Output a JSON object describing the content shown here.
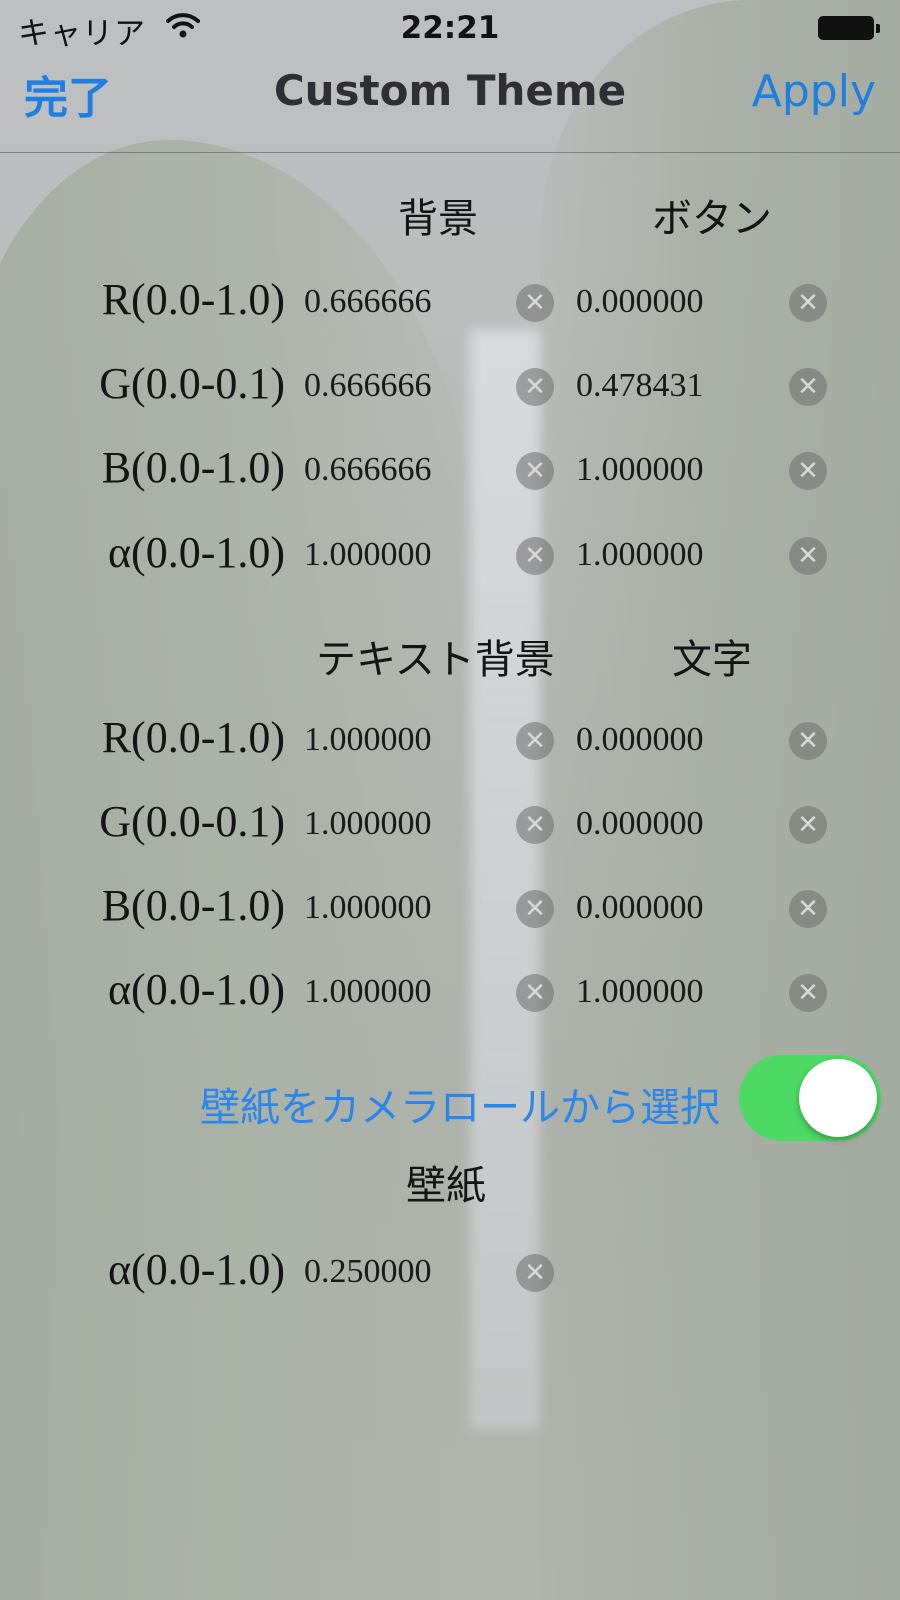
{
  "status_bar": {
    "carrier": "キャリア",
    "time": "22:21"
  },
  "nav": {
    "left_button": "完了",
    "title": "Custom Theme",
    "right_button": "Apply"
  },
  "section1": {
    "col1": "背景",
    "col2": "ボタン",
    "rows": [
      {
        "label": "R(0.0-1.0)",
        "v1": "0.666666",
        "v2": "0.000000"
      },
      {
        "label": "G(0.0-0.1)",
        "v1": "0.666666",
        "v2": "0.478431"
      },
      {
        "label": "B(0.0-1.0)",
        "v1": "0.666666",
        "v2": "1.000000"
      },
      {
        "label": "α(0.0-1.0)",
        "v1": "1.000000",
        "v2": "1.000000"
      }
    ]
  },
  "section2": {
    "col1": "テキスト背景",
    "col2": "文字",
    "rows": [
      {
        "label": "R(0.0-1.0)",
        "v1": "1.000000",
        "v2": "0.000000"
      },
      {
        "label": "G(0.0-0.1)",
        "v1": "1.000000",
        "v2": "0.000000"
      },
      {
        "label": "B(0.0-1.0)",
        "v1": "1.000000",
        "v2": "0.000000"
      },
      {
        "label": "α(0.0-1.0)",
        "v1": "1.000000",
        "v2": "1.000000"
      }
    ]
  },
  "wallpaper": {
    "camera_roll_label": "壁紙をカメラロールから選択",
    "camera_roll_toggle_on": true,
    "heading": "壁紙",
    "row": {
      "label": "α(0.0-1.0)",
      "v1": "0.250000"
    }
  },
  "colors": {
    "accent": "#1f7fe0",
    "toggle_on": "#4cd964"
  }
}
